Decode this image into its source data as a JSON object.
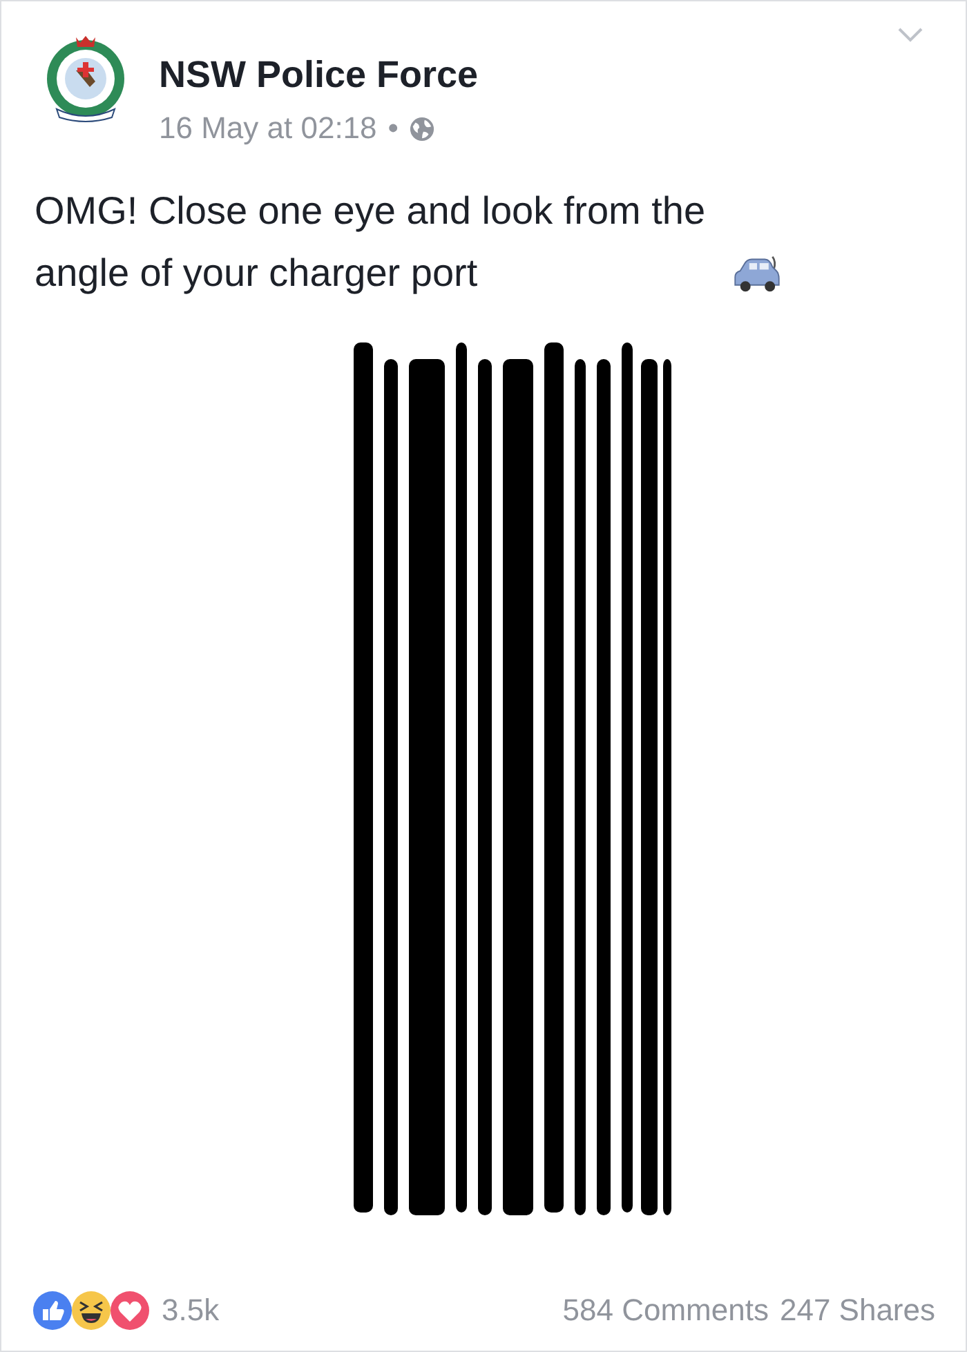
{
  "post": {
    "author": "NSW Police Force",
    "time": "16 May at 02:18",
    "separator": "•",
    "text": "OMG! Close one eye and look from the angle of your charger port"
  },
  "footer": {
    "reactions_count": "3.5k",
    "comments": "584 Comments",
    "shares": "247 Shares"
  }
}
